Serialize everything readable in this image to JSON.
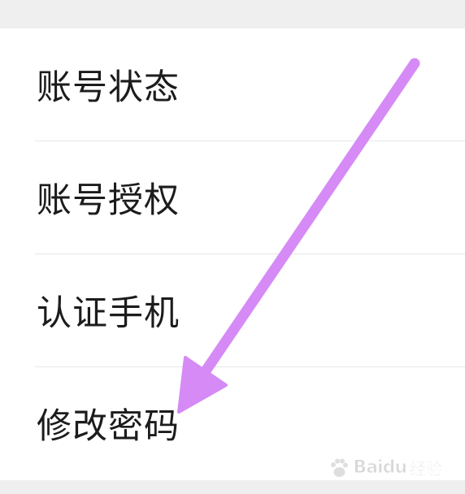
{
  "menu": {
    "items": [
      {
        "label": "账号状态"
      },
      {
        "label": "账号授权"
      },
      {
        "label": "认证手机"
      },
      {
        "label": "修改密码"
      }
    ]
  },
  "annotation": {
    "arrow_color": "#d58af6"
  },
  "watermark": {
    "brand": "Baidu",
    "suffix": "经验"
  }
}
